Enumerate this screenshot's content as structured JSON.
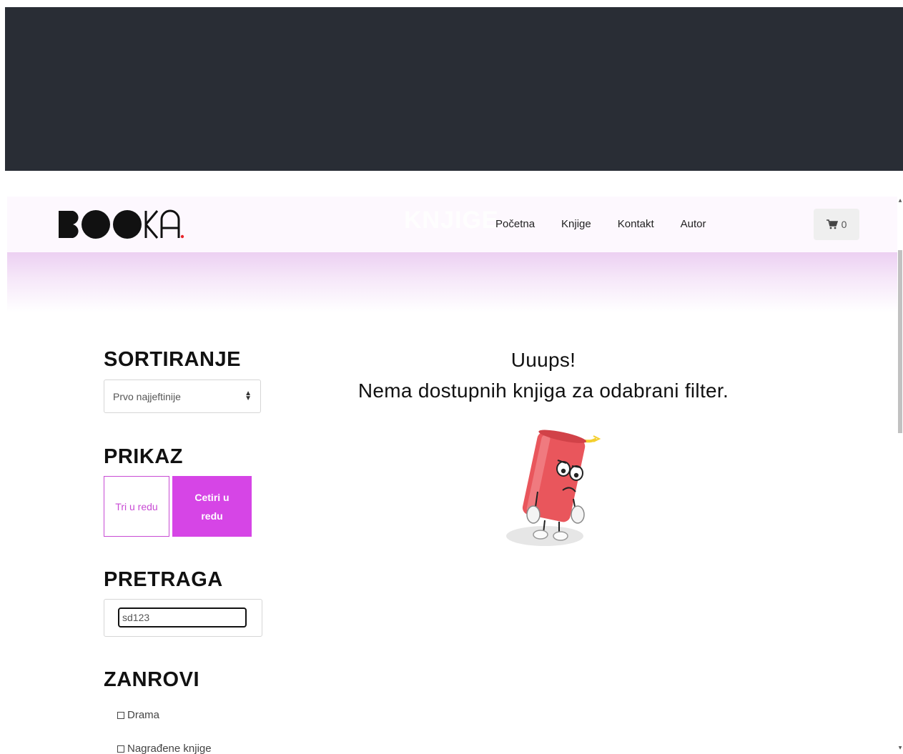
{
  "brand": {
    "logo_text": "BOOKA",
    "accent_color": "#d645e6",
    "logo_dot_color": "#e8252b"
  },
  "header": {
    "ghost_title": "KNJIGE"
  },
  "nav": {
    "items": [
      {
        "label": "Početna"
      },
      {
        "label": "Knjige"
      },
      {
        "label": "Kontakt"
      },
      {
        "label": "Autor"
      }
    ]
  },
  "cart": {
    "icon": "cart-icon",
    "count": "0"
  },
  "sidebar": {
    "sort": {
      "heading": "SORTIRANJE",
      "selected": "Prvo najjeftinije"
    },
    "view": {
      "heading": "PRIKAZ",
      "option_three": "Tri u redu",
      "option_four": "Cetiri u redu"
    },
    "search": {
      "heading": "PRETRAGA",
      "value": "sd123"
    },
    "genres": {
      "heading": "ZANROVI",
      "items": [
        {
          "label": "Drama"
        },
        {
          "label": "Nagrađene knjige"
        }
      ]
    }
  },
  "main": {
    "empty_title": "Uuups!",
    "empty_message": "Nema dostupnih knjiga za odabrani filter.",
    "illustration": "sad-dynamite-mascot"
  }
}
